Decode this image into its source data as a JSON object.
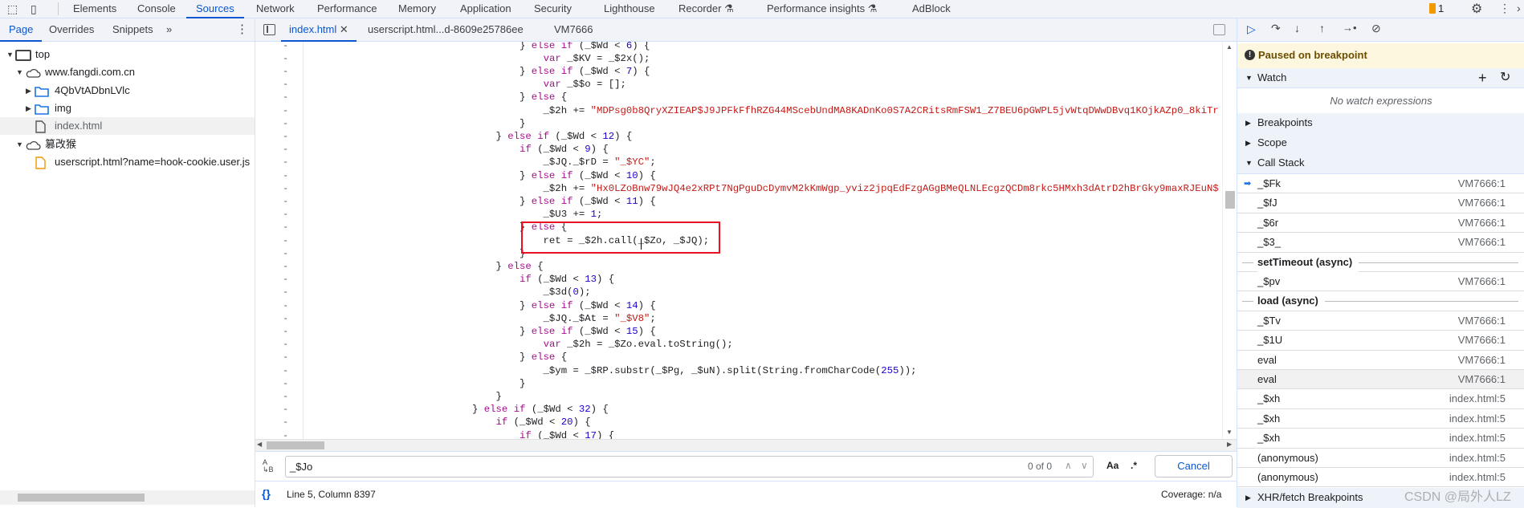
{
  "top_tabs": [
    "Elements",
    "Console",
    "Sources",
    "Network",
    "Performance",
    "Memory",
    "Application",
    "Security",
    "Lighthouse",
    "Recorder",
    "Performance insights",
    "AdBlock"
  ],
  "active_top_tab": "Sources",
  "issues_count": "1",
  "left": {
    "tabs": [
      "Page",
      "Overrides",
      "Snippets"
    ],
    "more": "»",
    "tree": [
      {
        "label": "top",
        "icon": "frame-icon",
        "level": 0,
        "arrow": "▼"
      },
      {
        "label": "www.fangdi.com.cn",
        "icon": "cloud-icon",
        "level": 1,
        "arrow": "▼"
      },
      {
        "label": "4QbVtADbnLVlc",
        "icon": "folder-icon",
        "level": 2,
        "arrow": "▶"
      },
      {
        "label": "img",
        "icon": "folder-icon",
        "level": 2,
        "arrow": "▶"
      },
      {
        "label": "index.html",
        "icon": "file-icon",
        "level": 2,
        "arrow": "",
        "selected": true
      },
      {
        "label": "篡改猴",
        "icon": "cloud-icon",
        "level": 1,
        "arrow": "▼"
      },
      {
        "label": "userscript.html?name=hook-cookie.user.js",
        "icon": "script-file-icon",
        "level": 2,
        "arrow": ""
      }
    ]
  },
  "editor": {
    "tabs": [
      "index.html",
      "userscript.html...d-8609e25786ee",
      "VM7666"
    ],
    "active_tab": "index.html",
    "gutter_mark": "-",
    "lines": [
      "        } else if (_$Wd < 6) {",
      "            var _$KV = _$2x();",
      "        } else if (_$Wd < 7) {",
      "            var _$$o = [];",
      "        } else {",
      "            _$2h += \"MDPsg0b8QryXZIEAP$J9JPFkFfhRZG44MScebUndMA8KADnKo0S7A2CRitsRmFSW1_Z7BEU6pGWPL5jvWtqDWwDBvq1KOjkAZp0_8kiTr",
      "        }",
      "    } else if (_$Wd < 12) {",
      "        if (_$Wd < 9) {",
      "            _$JQ._$rD = \"_$YC\";",
      "        } else if (_$Wd < 10) {",
      "            _$2h += \"Hx0LZoBnw79wJQ4e2xRPt7NgPguDcDymvM2kKmWgp_yviz2jpqEdFzgAGgBMeQLNLEcgzQCDm8rkc5HMxh3dAtrD2hBrGky9maxRJEuN$",
      "        } else if (_$Wd < 11) {",
      "            _$U3 += 1;",
      "        } else {",
      "            ret = _$2h.call(_$Zo, _$JQ);",
      "        }",
      "    } else {",
      "        if (_$Wd < 13) {",
      "            _$3d(0);",
      "        } else if (_$Wd < 14) {",
      "            _$JQ._$At = \"_$V8\";",
      "        } else if (_$Wd < 15) {",
      "            var _$2h = _$Zo.eval.toString();",
      "        } else {",
      "            _$ym = _$RP.substr(_$Pg, _$uN).split(String.fromCharCode(255));",
      "        }",
      "    }",
      "} else if (_$Wd < 32) {",
      "    if (_$Wd < 20) {",
      "        if (_$Wd < 17) {"
    ],
    "highlight_color": "#e81123"
  },
  "search": {
    "value": "_$Jo",
    "count": "0 of 0",
    "match_case": "Aa",
    "regex": ".*",
    "cancel": "Cancel"
  },
  "status": {
    "position": "Line 5, Column 8397",
    "coverage": "Coverage: n/a"
  },
  "debugger": {
    "paused": "Paused on breakpoint",
    "watch": "Watch",
    "no_watch": "No watch expressions",
    "breakpoints": "Breakpoints",
    "scope": "Scope",
    "call_stack": "Call Stack",
    "stack": [
      {
        "fn": "_$Fk",
        "loc": "VM7666:1",
        "current": true
      },
      {
        "fn": "_$fJ",
        "loc": "VM7666:1"
      },
      {
        "fn": "_$6r",
        "loc": "VM7666:1"
      },
      {
        "fn": "_$3_",
        "loc": "VM7666:1"
      },
      {
        "async": "setTimeout (async)"
      },
      {
        "fn": "_$pv",
        "loc": "VM7666:1"
      },
      {
        "async": "load (async)"
      },
      {
        "fn": "_$Tv",
        "loc": "VM7666:1"
      },
      {
        "fn": "_$1U",
        "loc": "VM7666:1"
      },
      {
        "fn": "eval",
        "loc": "VM7666:1"
      },
      {
        "fn": "eval",
        "loc": "VM7666:1",
        "hover": true
      },
      {
        "fn": "_$xh",
        "loc": "index.html:5"
      },
      {
        "fn": "_$xh",
        "loc": "index.html:5"
      },
      {
        "fn": "_$xh",
        "loc": "index.html:5"
      },
      {
        "fn": "(anonymous)",
        "loc": "index.html:5"
      },
      {
        "fn": "(anonymous)",
        "loc": "index.html:5"
      }
    ],
    "xhr": "XHR/fetch Breakpoints"
  },
  "watermark": "CSDN @局外人LZ",
  "colors": {
    "accent": "#0b57d0",
    "paused_bg": "#fef7e0",
    "keyword": "#aa0d91",
    "number": "#1c00cf",
    "string": "#c41a16"
  }
}
